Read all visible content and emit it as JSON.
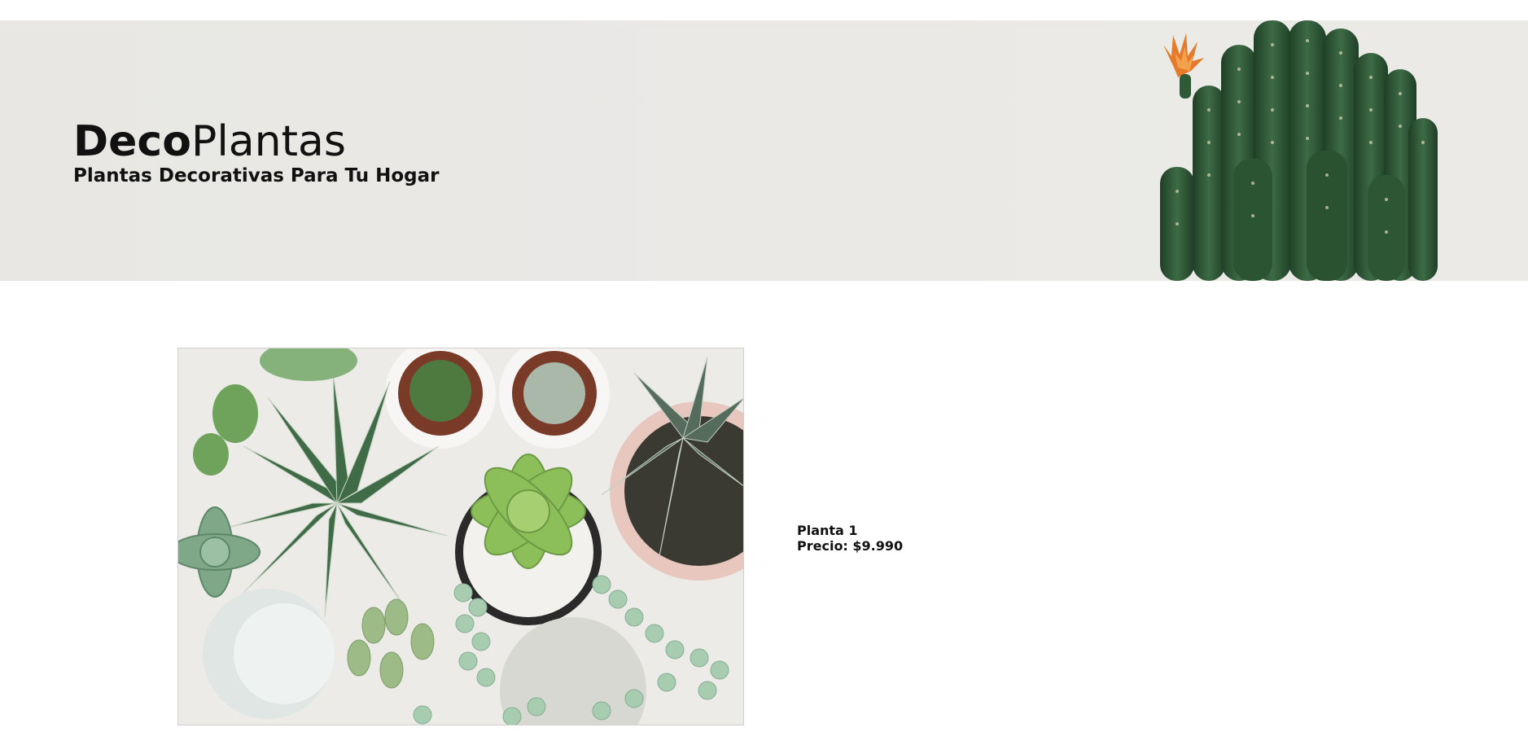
{
  "header": {
    "brand_bold": "Deco",
    "brand_light": "Plantas",
    "subtitle": "Plantas Decorativas Para Tu Hogar",
    "background_color": "#e9e8e5",
    "hero_image": "cactus-with-orange-flower-image"
  },
  "product": {
    "image": "succulents-top-view-image",
    "name": "Planta 1",
    "price_label": "Precio: $9.990"
  },
  "colors": {
    "text": "#111111",
    "cactus_green": "#2f5a36",
    "flower_orange": "#e47a2a",
    "succulent_green": "#8cbf5a"
  }
}
